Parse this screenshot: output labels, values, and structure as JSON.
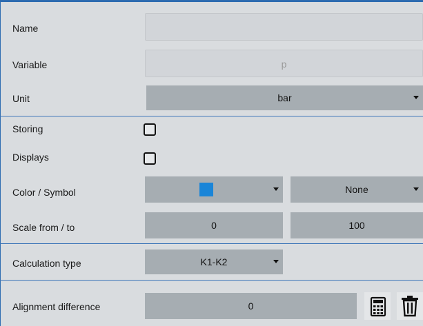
{
  "name": {
    "label": "Name",
    "value": ""
  },
  "variable": {
    "label": "Variable",
    "placeholder": "p"
  },
  "unit": {
    "label": "Unit",
    "value": "bar"
  },
  "storing": {
    "label": "Storing",
    "checked": false
  },
  "displays": {
    "label": "Displays",
    "checked": false
  },
  "color_symbol": {
    "label": "Color / Symbol",
    "color": "#1a85d8",
    "symbol": "None"
  },
  "scale": {
    "label": "Scale from / to",
    "from": "0",
    "to": "100"
  },
  "calculation": {
    "label": "Calculation type",
    "value": "K1-K2"
  },
  "alignment": {
    "label": "Alignment difference",
    "value": "0"
  },
  "icons": {
    "calculator": "calculator-icon",
    "delete": "trash-icon"
  }
}
